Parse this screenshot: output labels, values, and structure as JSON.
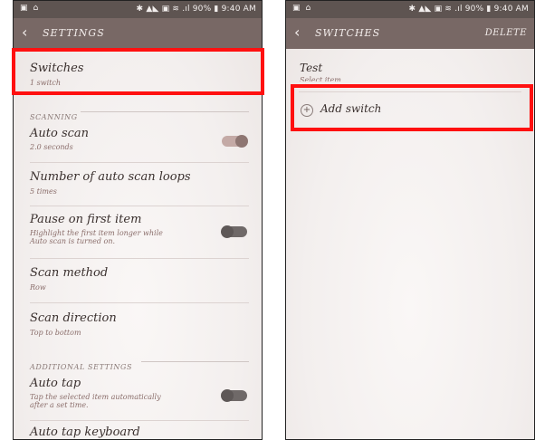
{
  "status_bar": {
    "right_text": "✱ ▲◣ ▣ ≋ .ıl 90% ▮ 9:40 AM"
  },
  "settings_screen": {
    "title": "SETTINGS",
    "switches": {
      "title": "Switches",
      "subtitle": "1 switch"
    },
    "section_scanning": "SCANNING",
    "auto_scan": {
      "title": "Auto scan",
      "subtitle": "2.0 seconds",
      "enabled": true
    },
    "auto_scan_loops": {
      "title": "Number of auto scan loops",
      "subtitle": "5 times"
    },
    "pause_first": {
      "title": "Pause on first item",
      "subtitle_line1": "Highlight the first item longer while",
      "subtitle_line2": "Auto scan is turned on.",
      "enabled": false
    },
    "scan_method": {
      "title": "Scan method",
      "subtitle": "Row"
    },
    "scan_direction": {
      "title": "Scan direction",
      "subtitle": "Top to bottom"
    },
    "section_additional": "ADDITIONAL SETTINGS",
    "auto_tap": {
      "title": "Auto tap",
      "subtitle_line1": "Tap the selected item automatically",
      "subtitle_line2": "after a set time.",
      "enabled": false
    },
    "auto_tap_keyboard": {
      "title": "Auto tap keyboard"
    }
  },
  "switches_screen": {
    "title": "SWITCHES",
    "delete_label": "DELETE",
    "item": {
      "title": "Test",
      "subtitle": "Select item"
    },
    "add_switch_label": "Add switch"
  },
  "colors": {
    "status_bar": "#5e5451",
    "app_bar": "#786865",
    "highlight": "#ff1010"
  }
}
